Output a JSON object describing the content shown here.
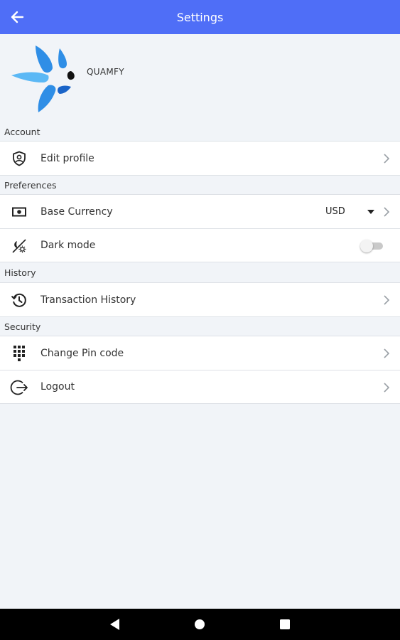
{
  "header": {
    "title": "Settings",
    "back_icon": "arrow-left-icon"
  },
  "profile": {
    "brand_name": "QUAMFY"
  },
  "sections": {
    "account": {
      "title": "Account",
      "items": [
        {
          "label": "Edit profile",
          "icon": "shield-user-icon"
        }
      ]
    },
    "preferences": {
      "title": "Preferences",
      "items": [
        {
          "label": "Base Currency",
          "icon": "banknote-icon",
          "value": "USD"
        },
        {
          "label": "Dark mode",
          "icon": "theme-toggle-icon",
          "toggle_on": false
        }
      ]
    },
    "history": {
      "title": "History",
      "items": [
        {
          "label": "Transaction History",
          "icon": "history-icon"
        }
      ]
    },
    "security": {
      "title": "Security",
      "items": [
        {
          "label": "Change Pin code",
          "icon": "dialpad-icon"
        },
        {
          "label": "Logout",
          "icon": "logout-icon"
        }
      ]
    }
  },
  "colors": {
    "appbar": "#4f6ef7",
    "background": "#f1f4f8",
    "logo_light": "#5bb8f5",
    "logo_mid": "#2f8ee6",
    "logo_dark": "#1a64c8"
  },
  "navbar": {
    "buttons": [
      "back-triangle-icon",
      "home-circle-icon",
      "recents-square-icon"
    ]
  }
}
